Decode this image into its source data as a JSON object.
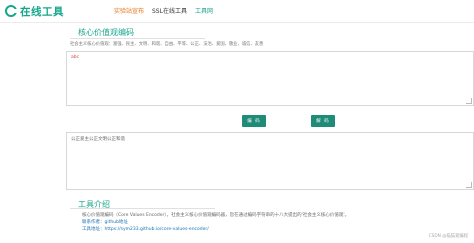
{
  "header": {
    "logo_text": "在线工具",
    "nav": [
      {
        "label": "实验站宣布"
      },
      {
        "label": "SSL在线工具"
      },
      {
        "label": "工具网"
      }
    ]
  },
  "main": {
    "title": "核心价值观编码",
    "value_words": "社会主义核心价值观：富强、民主、文明、和谐、自由、平等、公正、法治、爱国、敬业、诚信、友善",
    "input_text": "abc",
    "encode_label": "编 码",
    "decode_label": "解 码",
    "output_text": "公正爱主公正文明公正和谐"
  },
  "intro": {
    "title": "工具介绍",
    "lines": [
      "核心价值观编码（Core Values Encoder），社会主义核心价值观编码器，旨在通过编码字符串的十八大提出的'社会主义核心价值观'。",
      "联系作者：github地址",
      "工具地址：https://sym233.github.io/core-values-encoder/"
    ]
  },
  "footer": {
    "watermark": "CSDN @猫猫爱编程"
  },
  "colors": {
    "brand": "#16a68c",
    "button": "#1e8c76",
    "active_nav": "#e8741c",
    "input_text": "#d0464a"
  }
}
